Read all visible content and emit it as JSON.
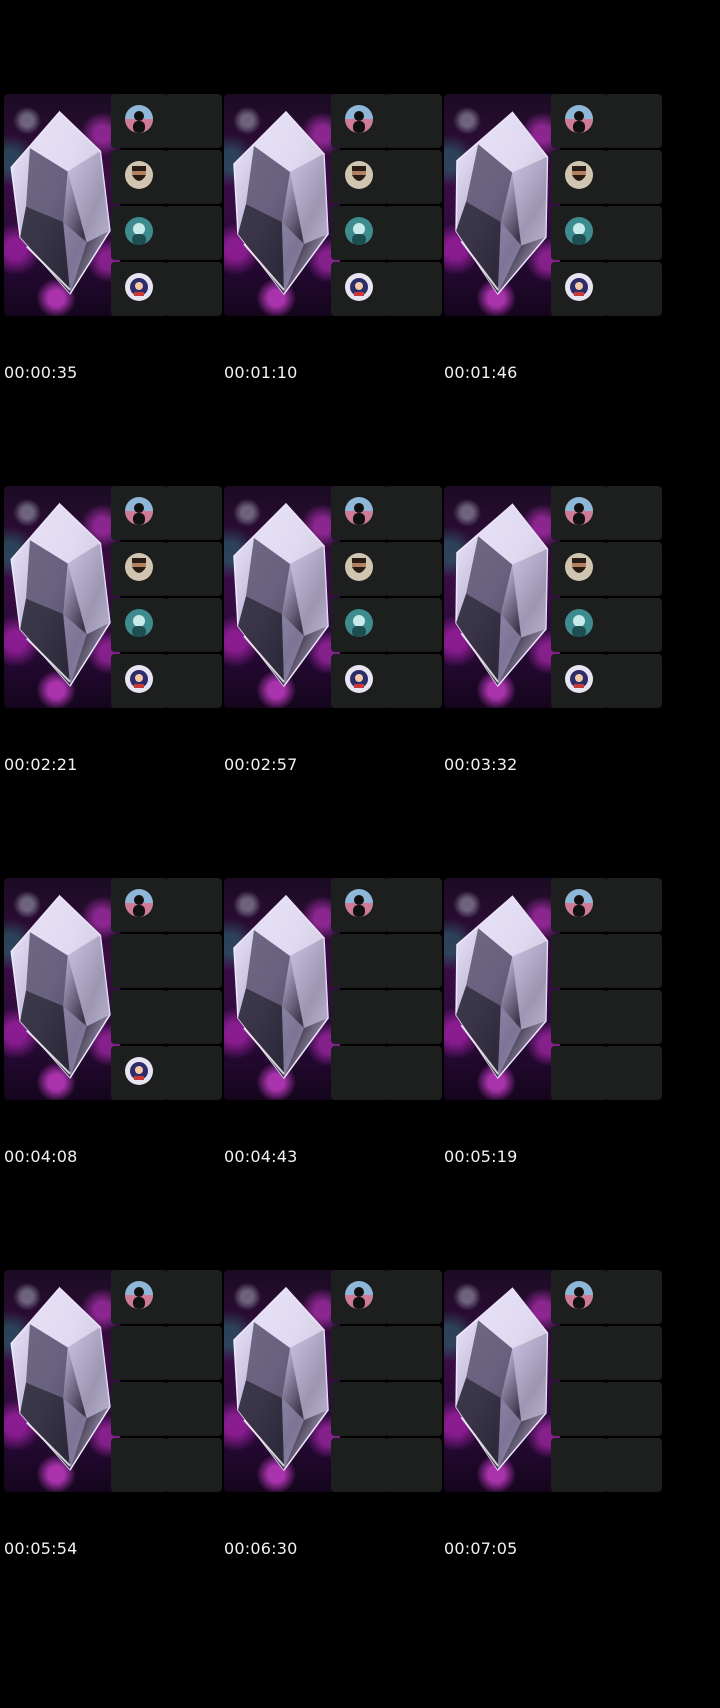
{
  "frames": [
    {
      "timestamp": "00:00:35",
      "avatars": [
        "person-silhouette-avatar",
        "bearded-man-avatar",
        "teal-portrait-avatar",
        "astronaut-avatar"
      ]
    },
    {
      "timestamp": "00:01:10",
      "avatars": [
        "person-silhouette-avatar",
        "bearded-man-avatar",
        "teal-portrait-avatar",
        "astronaut-avatar"
      ]
    },
    {
      "timestamp": "00:01:46",
      "avatars": [
        "person-silhouette-avatar",
        "bearded-man-avatar",
        "teal-portrait-avatar",
        "astronaut-avatar"
      ]
    },
    {
      "timestamp": "00:02:21",
      "avatars": [
        "person-silhouette-avatar",
        "bearded-man-avatar",
        "teal-portrait-avatar",
        "astronaut-avatar"
      ]
    },
    {
      "timestamp": "00:02:57",
      "avatars": [
        "person-silhouette-avatar",
        "bearded-man-avatar",
        "teal-portrait-avatar",
        "astronaut-avatar"
      ]
    },
    {
      "timestamp": "00:03:32",
      "avatars": [
        "person-silhouette-avatar",
        "bearded-man-avatar",
        "teal-portrait-avatar",
        "astronaut-avatar"
      ]
    },
    {
      "timestamp": "00:04:08",
      "avatars": [
        "person-silhouette-avatar",
        null,
        null,
        "astronaut-avatar"
      ]
    },
    {
      "timestamp": "00:04:43",
      "avatars": [
        "person-silhouette-avatar",
        null,
        null,
        null
      ]
    },
    {
      "timestamp": "00:05:19",
      "avatars": [
        "person-silhouette-avatar",
        null,
        null,
        null
      ]
    },
    {
      "timestamp": "00:05:54",
      "avatars": [
        "person-silhouette-avatar",
        null,
        null,
        null
      ]
    },
    {
      "timestamp": "00:06:30",
      "avatars": [
        "person-silhouette-avatar",
        null,
        null,
        null
      ]
    },
    {
      "timestamp": "00:07:05",
      "avatars": [
        "person-silhouette-avatar",
        null,
        null,
        null
      ]
    }
  ],
  "colors": {
    "background": "#000000",
    "tile": "#1d1e1e",
    "accent_magenta": "#d23cdc",
    "timestamp_text": "#f2f2f2"
  }
}
